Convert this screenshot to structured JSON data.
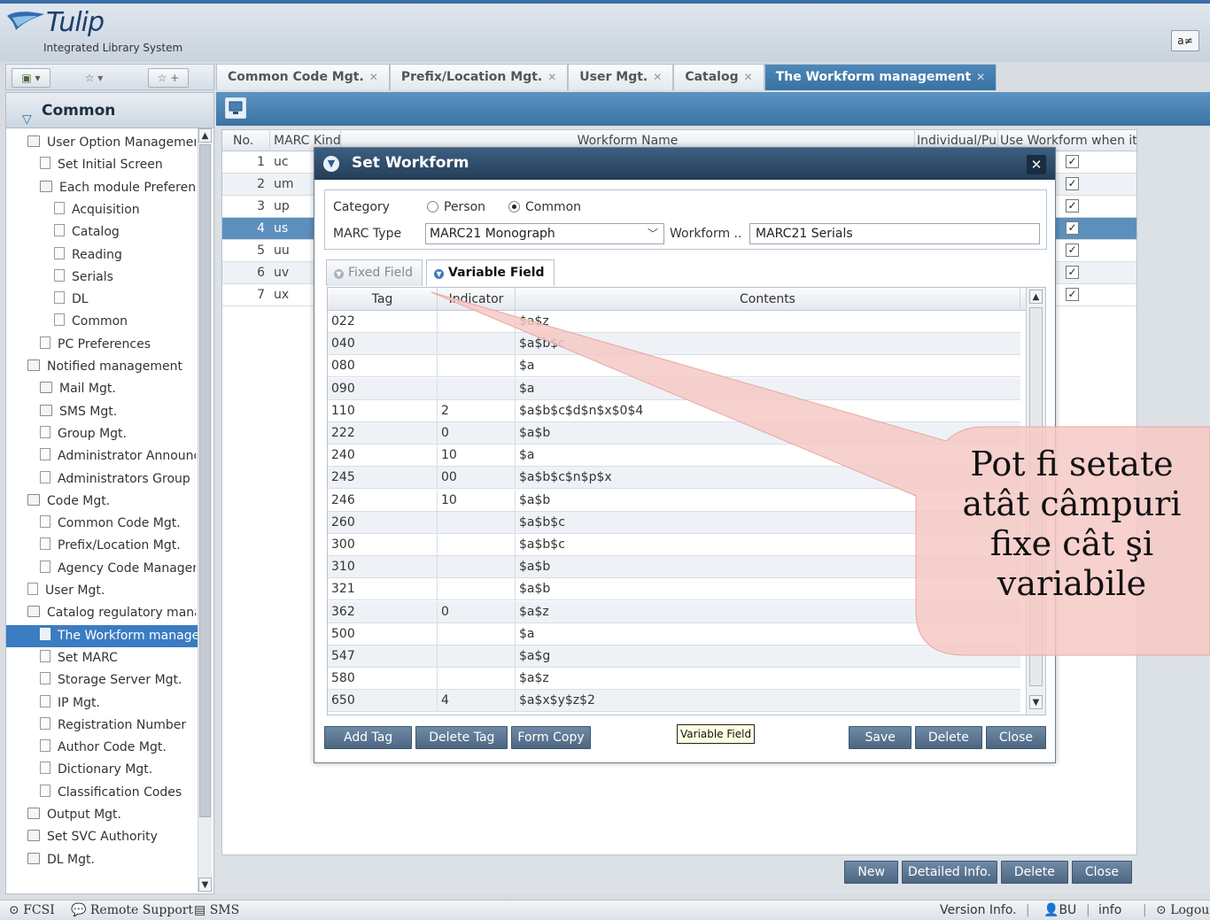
{
  "app": {
    "title": "Tulip",
    "subtitle": "Integrated Library System",
    "top_right_label": "a≠"
  },
  "tabs": [
    {
      "label": "Common Code Mgt."
    },
    {
      "label": "Prefix/Location Mgt."
    },
    {
      "label": "User Mgt."
    },
    {
      "label": "Catalog"
    },
    {
      "label": "The Workform management",
      "active": true
    }
  ],
  "sidebar": {
    "title": "Common",
    "items": [
      {
        "label": "User Option Management",
        "icon": "folder-open-icon",
        "level": 0
      },
      {
        "label": "Set Initial Screen",
        "icon": "document-icon",
        "level": 1
      },
      {
        "label": "Each module Preferences",
        "icon": "folder-open-icon",
        "level": 1
      },
      {
        "label": "Acquisition",
        "icon": "document-icon",
        "level": 2
      },
      {
        "label": "Catalog",
        "icon": "document-icon",
        "level": 2
      },
      {
        "label": "Reading",
        "icon": "document-icon",
        "level": 2
      },
      {
        "label": "Serials",
        "icon": "document-icon",
        "level": 2
      },
      {
        "label": "DL",
        "icon": "document-icon",
        "level": 2
      },
      {
        "label": "Common",
        "icon": "document-icon",
        "level": 2
      },
      {
        "label": "PC Preferences",
        "icon": "document-icon",
        "level": 1
      },
      {
        "label": "Notified management",
        "icon": "folder-open-icon",
        "level": 0
      },
      {
        "label": "Mail Mgt.",
        "icon": "folder-icon",
        "level": 1
      },
      {
        "label": "SMS Mgt.",
        "icon": "folder-icon",
        "level": 1
      },
      {
        "label": "Group Mgt.",
        "icon": "document-icon",
        "level": 1
      },
      {
        "label": "Administrator Announcement",
        "icon": "document-icon",
        "level": 1
      },
      {
        "label": "Administrators Group",
        "icon": "document-icon",
        "level": 1
      },
      {
        "label": "Code Mgt.",
        "icon": "folder-open-icon",
        "level": 0
      },
      {
        "label": "Common Code Mgt.",
        "icon": "document-icon",
        "level": 1
      },
      {
        "label": "Prefix/Location Mgt.",
        "icon": "document-icon",
        "level": 1
      },
      {
        "label": "Agency Code Management",
        "icon": "document-icon",
        "level": 1
      },
      {
        "label": "User Mgt.",
        "icon": "document-icon",
        "level": 0
      },
      {
        "label": "Catalog regulatory management",
        "icon": "folder-open-icon",
        "level": 0
      },
      {
        "label": "The Workform management",
        "icon": "document-icon",
        "level": 1,
        "selected": true
      },
      {
        "label": "Set MARC",
        "icon": "document-icon",
        "level": 1
      },
      {
        "label": "Storage Server Mgt.",
        "icon": "document-icon",
        "level": 1
      },
      {
        "label": "IP Mgt.",
        "icon": "document-icon",
        "level": 1
      },
      {
        "label": "Registration Number",
        "icon": "document-icon",
        "level": 1
      },
      {
        "label": "Author Code Mgt.",
        "icon": "document-icon",
        "level": 1
      },
      {
        "label": "Dictionary Mgt.",
        "icon": "document-icon",
        "level": 1
      },
      {
        "label": "Classification Codes",
        "icon": "document-icon",
        "level": 1
      },
      {
        "label": "Output Mgt.",
        "icon": "folder-icon",
        "level": 0
      },
      {
        "label": "Set SVC Authority",
        "icon": "folder-icon",
        "level": 0
      },
      {
        "label": "DL Mgt.",
        "icon": "folder-icon",
        "level": 0
      }
    ]
  },
  "grid": {
    "columns": [
      "No.",
      "MARC Kind",
      "Workform Name",
      "Individual/Public",
      "Use Workform when it"
    ],
    "rows": [
      {
        "no": "1",
        "kind": "uc",
        "checked": true
      },
      {
        "no": "2",
        "kind": "um",
        "checked": true
      },
      {
        "no": "3",
        "kind": "up",
        "checked": true
      },
      {
        "no": "4",
        "kind": "us",
        "checked": true,
        "selected": true
      },
      {
        "no": "5",
        "kind": "uu",
        "checked": true
      },
      {
        "no": "6",
        "kind": "uv",
        "checked": true
      },
      {
        "no": "7",
        "kind": "ux",
        "checked": true
      }
    ],
    "buttons": {
      "new": "New",
      "detailed": "Detailed Info.",
      "delete": "Delete",
      "close": "Close"
    }
  },
  "modal": {
    "title": "Set Workform",
    "category_label": "Category",
    "category_options": [
      "Person",
      "Common"
    ],
    "category_selected": "Common",
    "marc_type_label": "MARC Type",
    "marc_type_value": "MARC21 Monograph",
    "workform_label": "Workform ..",
    "workform_value": "MARC21 Serials",
    "subtabs": [
      {
        "label": "Fixed Field",
        "active": false
      },
      {
        "label": "Variable Field",
        "active": true
      }
    ],
    "table": {
      "columns": [
        "Tag",
        "Indicator",
        "Contents"
      ],
      "rows": [
        {
          "tag": "022",
          "indicator": "",
          "contents": "$a$z"
        },
        {
          "tag": "040",
          "indicator": "",
          "contents": "$a$b$c"
        },
        {
          "tag": "080",
          "indicator": "",
          "contents": "$a"
        },
        {
          "tag": "090",
          "indicator": "",
          "contents": "$a"
        },
        {
          "tag": "110",
          "indicator": "2",
          "contents": "$a$b$c$d$n$x$0$4"
        },
        {
          "tag": "222",
          "indicator": " 0",
          "contents": "$a$b"
        },
        {
          "tag": "240",
          "indicator": "10",
          "contents": "$a"
        },
        {
          "tag": "245",
          "indicator": "00",
          "contents": "$a$b$c$n$p$x"
        },
        {
          "tag": "246",
          "indicator": "10",
          "contents": "$a$b"
        },
        {
          "tag": "260",
          "indicator": "",
          "contents": "$a$b$c"
        },
        {
          "tag": "300",
          "indicator": "",
          "contents": "$a$b$c"
        },
        {
          "tag": "310",
          "indicator": "",
          "contents": "$a$b"
        },
        {
          "tag": "321",
          "indicator": "",
          "contents": "$a$b"
        },
        {
          "tag": "362",
          "indicator": "0",
          "contents": "$a$z"
        },
        {
          "tag": "500",
          "indicator": "",
          "contents": "$a"
        },
        {
          "tag": "547",
          "indicator": "",
          "contents": "$a$g"
        },
        {
          "tag": "580",
          "indicator": "",
          "contents": "$a$z"
        },
        {
          "tag": "650",
          "indicator": " 4",
          "contents": "$a$x$y$z$2"
        }
      ]
    },
    "buttons": {
      "add_tag": "Add Tag",
      "delete_tag": "Delete Tag",
      "form_copy": "Form Copy",
      "save": "Save",
      "delete": "Delete",
      "close": "Close"
    },
    "tooltip": "Variable Field"
  },
  "callout": {
    "lines": [
      "Pot fi setate",
      "atât câmpuri",
      "fixe cât şi",
      "variabile"
    ],
    "color": "#f6c9c4"
  },
  "status": {
    "left": [
      "FCSI",
      "Remote Support",
      "SMS"
    ],
    "version": "Version Info.",
    "user": "BU",
    "info": "info",
    "logout": "Logout"
  },
  "colors": {
    "accent": "#3b7cc2",
    "header": "#3c73a3",
    "button": "#5b7591"
  }
}
